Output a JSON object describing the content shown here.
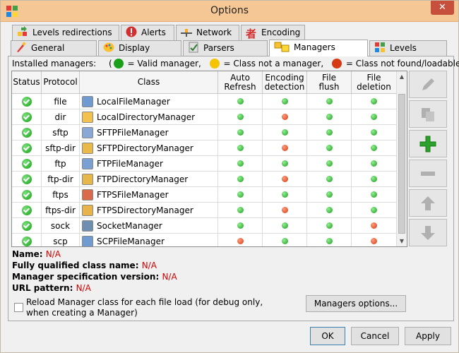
{
  "window": {
    "title": "Options"
  },
  "tabs_top": [
    {
      "label": "Levels redirections",
      "icon": "levels-redirections-icon"
    },
    {
      "label": "Alerts",
      "icon": "alert-icon"
    },
    {
      "label": "Network",
      "icon": "network-icon"
    },
    {
      "label": "Encoding",
      "icon": "encoding-icon"
    }
  ],
  "tabs_bottom": [
    {
      "label": "General",
      "icon": "general-icon"
    },
    {
      "label": "Display",
      "icon": "display-icon"
    },
    {
      "label": "Parsers",
      "icon": "parsers-icon"
    },
    {
      "label": "Managers",
      "icon": "managers-icon"
    },
    {
      "label": "Levels",
      "icon": "levels-icon"
    }
  ],
  "legend": {
    "prefix": "Installed managers:",
    "valid": "= Valid manager,",
    "not_manager": "= Class not a manager,",
    "not_found": "= Class not found/loadable)",
    "open_paren": "("
  },
  "table": {
    "headers": {
      "status": "Status",
      "protocol": "Protocol",
      "class": "Class",
      "auto_refresh_1": "Auto",
      "auto_refresh_2": "Refresh",
      "encoding_1": "Encoding",
      "encoding_2": "detection",
      "file_flush_1": "File",
      "file_flush_2": "flush",
      "file_deletion_1": "File",
      "file_deletion_2": "deletion"
    },
    "rows": [
      {
        "protocol": "file",
        "class": "LocalFileManager",
        "icon": "file-icon",
        "auto": "green",
        "enc": "green",
        "flush": "green",
        "del": "green"
      },
      {
        "protocol": "dir",
        "class": "LocalDirectoryManager",
        "icon": "folder-icon",
        "auto": "green",
        "enc": "red",
        "flush": "green",
        "del": "green"
      },
      {
        "protocol": "sftp",
        "class": "SFTPFileManager",
        "icon": "secure-file-icon",
        "auto": "green",
        "enc": "green",
        "flush": "green",
        "del": "green"
      },
      {
        "protocol": "sftp-dir",
        "class": "SFTPDirectoryManager",
        "icon": "secure-folder-icon",
        "auto": "green",
        "enc": "red",
        "flush": "green",
        "del": "green"
      },
      {
        "protocol": "ftp",
        "class": "FTPFileManager",
        "icon": "ftp-file-icon",
        "auto": "green",
        "enc": "green",
        "flush": "green",
        "del": "green"
      },
      {
        "protocol": "ftp-dir",
        "class": "FTPDirectoryManager",
        "icon": "ftp-folder-icon",
        "auto": "green",
        "enc": "red",
        "flush": "green",
        "del": "green"
      },
      {
        "protocol": "ftps",
        "class": "FTPSFileManager",
        "icon": "ftps-file-icon",
        "auto": "green",
        "enc": "green",
        "flush": "green",
        "del": "green"
      },
      {
        "protocol": "ftps-dir",
        "class": "FTPSDirectoryManager",
        "icon": "ftps-folder-icon",
        "auto": "green",
        "enc": "red",
        "flush": "green",
        "del": "green"
      },
      {
        "protocol": "sock",
        "class": "SocketManager",
        "icon": "socket-icon",
        "auto": "green",
        "enc": "green",
        "flush": "green",
        "del": "red"
      },
      {
        "protocol": "scp",
        "class": "SCPFileManager",
        "icon": "scp-file-icon",
        "auto": "red",
        "enc": "green",
        "flush": "green",
        "del": "red"
      }
    ]
  },
  "side_buttons": [
    {
      "name": "edit-button",
      "icon": "pencil-icon",
      "enabled": false
    },
    {
      "name": "copy-button",
      "icon": "copy-icon",
      "enabled": false
    },
    {
      "name": "add-button",
      "icon": "plus-icon",
      "enabled": true
    },
    {
      "name": "remove-button",
      "icon": "minus-icon",
      "enabled": false
    },
    {
      "name": "move-up-button",
      "icon": "arrow-up-icon",
      "enabled": false
    },
    {
      "name": "move-down-button",
      "icon": "arrow-down-icon",
      "enabled": false
    }
  ],
  "details": {
    "name_label": "Name:",
    "name_value": "N/A",
    "fqcn_label": "Fully qualified class name:",
    "fqcn_value": "N/A",
    "spec_label": "Manager specification version:",
    "spec_value": "N/A",
    "url_label": "URL pattern:",
    "url_value": "N/A"
  },
  "reload_checkbox": {
    "label": "Reload Manager class for each file load (for debug only, when creating a Manager)",
    "checked": false
  },
  "buttons": {
    "managers_options": "Managers options...",
    "ok": "OK",
    "cancel": "Cancel",
    "apply": "Apply"
  },
  "colors": {
    "titlebar": "#f5c795",
    "close": "#c7503c",
    "valid": "#18a118",
    "error": "#d43b14",
    "value_red": "#d00000"
  }
}
